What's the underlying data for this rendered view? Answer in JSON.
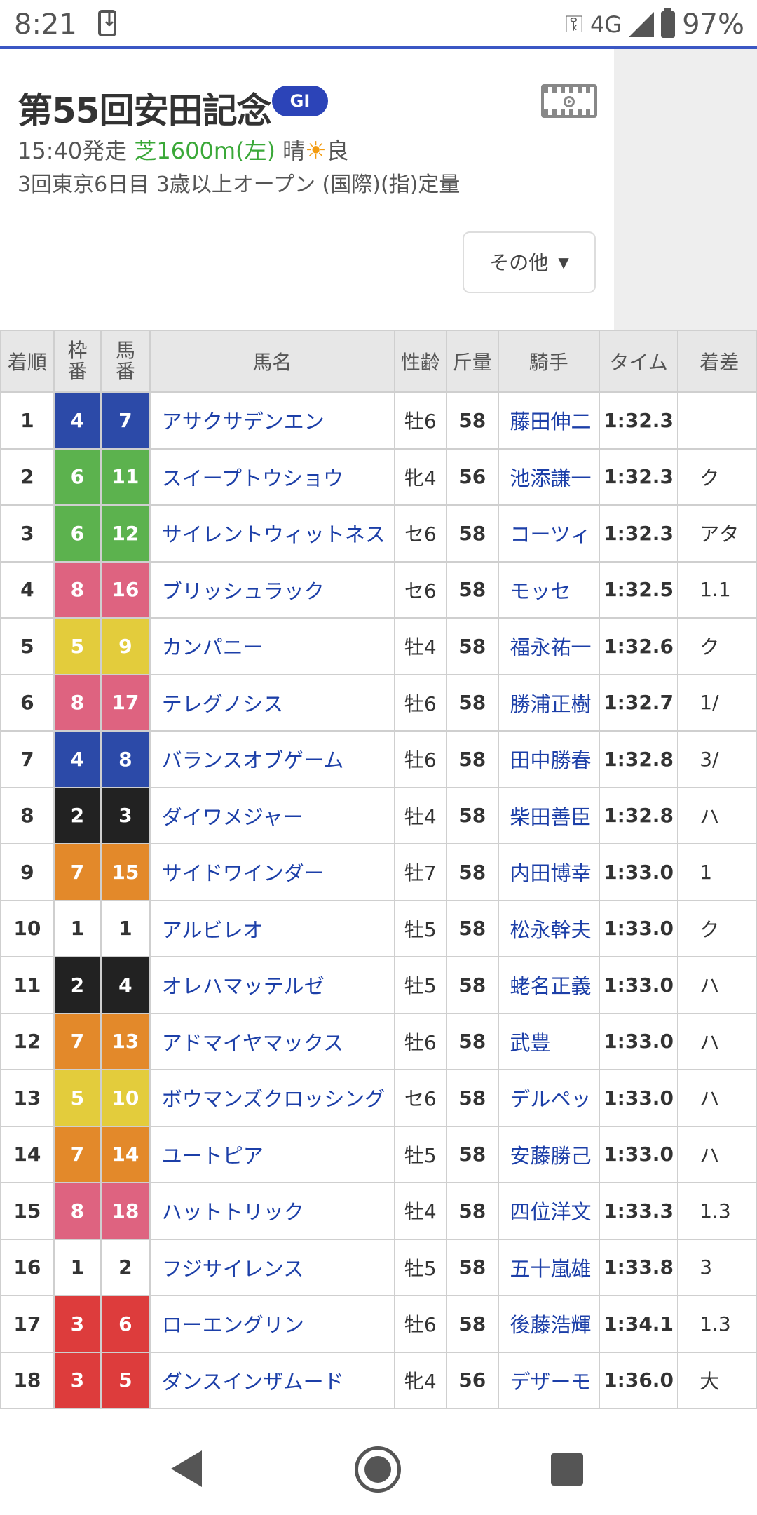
{
  "status": {
    "time": "8:21",
    "network": "4G",
    "battery": "97%"
  },
  "race": {
    "title": "第55回安田記念",
    "grade": "GI",
    "post_time": "15:40発走",
    "course": "芝1600m(左)",
    "weather": "晴",
    "going": "良",
    "conditions": "3回東京6日目 3歳以上オープン (国際)(指)定量",
    "other_button": "その他"
  },
  "table": {
    "headers": {
      "rank": "着順",
      "waku": "枠番",
      "umaban": "馬番",
      "name": "馬名",
      "sexage": "性齢",
      "weight": "斤量",
      "jockey": "騎手",
      "time": "タイム",
      "margin": "着差"
    },
    "rows": [
      {
        "rank": "1",
        "waku": "4",
        "umaban": "7",
        "name": "アサクサデンエン",
        "sexage": "牡6",
        "weight": "58",
        "jockey": "藤田伸二",
        "time": "1:32.3",
        "margin": ""
      },
      {
        "rank": "2",
        "waku": "6",
        "umaban": "11",
        "name": "スイープトウショウ",
        "sexage": "牝4",
        "weight": "56",
        "jockey": "池添謙一",
        "time": "1:32.3",
        "margin": "ク"
      },
      {
        "rank": "3",
        "waku": "6",
        "umaban": "12",
        "name": "サイレントウィットネス",
        "sexage": "セ6",
        "weight": "58",
        "jockey": "コーツィ",
        "time": "1:32.3",
        "margin": "アタ"
      },
      {
        "rank": "4",
        "waku": "8",
        "umaban": "16",
        "name": "ブリッシュラック",
        "sexage": "セ6",
        "weight": "58",
        "jockey": "モッセ",
        "time": "1:32.5",
        "margin": "1.1"
      },
      {
        "rank": "5",
        "waku": "5",
        "umaban": "9",
        "name": "カンパニー",
        "sexage": "牡4",
        "weight": "58",
        "jockey": "福永祐一",
        "time": "1:32.6",
        "margin": "ク"
      },
      {
        "rank": "6",
        "waku": "8",
        "umaban": "17",
        "name": "テレグノシス",
        "sexage": "牡6",
        "weight": "58",
        "jockey": "勝浦正樹",
        "time": "1:32.7",
        "margin": "1/"
      },
      {
        "rank": "7",
        "waku": "4",
        "umaban": "8",
        "name": "バランスオブゲーム",
        "sexage": "牡6",
        "weight": "58",
        "jockey": "田中勝春",
        "time": "1:32.8",
        "margin": "3/"
      },
      {
        "rank": "8",
        "waku": "2",
        "umaban": "3",
        "name": "ダイワメジャー",
        "sexage": "牡4",
        "weight": "58",
        "jockey": "柴田善臣",
        "time": "1:32.8",
        "margin": "ハ"
      },
      {
        "rank": "9",
        "waku": "7",
        "umaban": "15",
        "name": "サイドワインダー",
        "sexage": "牡7",
        "weight": "58",
        "jockey": "内田博幸",
        "time": "1:33.0",
        "margin": "1"
      },
      {
        "rank": "10",
        "waku": "1",
        "umaban": "1",
        "name": "アルビレオ",
        "sexage": "牡5",
        "weight": "58",
        "jockey": "松永幹夫",
        "time": "1:33.0",
        "margin": "ク"
      },
      {
        "rank": "11",
        "waku": "2",
        "umaban": "4",
        "name": "オレハマッテルゼ",
        "sexage": "牡5",
        "weight": "58",
        "jockey": "蛯名正義",
        "time": "1:33.0",
        "margin": "ハ"
      },
      {
        "rank": "12",
        "waku": "7",
        "umaban": "13",
        "name": "アドマイヤマックス",
        "sexage": "牡6",
        "weight": "58",
        "jockey": "武豊",
        "time": "1:33.0",
        "margin": "ハ"
      },
      {
        "rank": "13",
        "waku": "5",
        "umaban": "10",
        "name": "ボウマンズクロッシング",
        "sexage": "セ6",
        "weight": "58",
        "jockey": "デルペッ",
        "time": "1:33.0",
        "margin": "ハ"
      },
      {
        "rank": "14",
        "waku": "7",
        "umaban": "14",
        "name": "ユートピア",
        "sexage": "牡5",
        "weight": "58",
        "jockey": "安藤勝己",
        "time": "1:33.0",
        "margin": "ハ"
      },
      {
        "rank": "15",
        "waku": "8",
        "umaban": "18",
        "name": "ハットトリック",
        "sexage": "牡4",
        "weight": "58",
        "jockey": "四位洋文",
        "time": "1:33.3",
        "margin": "1.3"
      },
      {
        "rank": "16",
        "waku": "1",
        "umaban": "2",
        "name": "フジサイレンス",
        "sexage": "牡5",
        "weight": "58",
        "jockey": "五十嵐雄",
        "time": "1:33.8",
        "margin": "3"
      },
      {
        "rank": "17",
        "waku": "3",
        "umaban": "6",
        "name": "ローエングリン",
        "sexage": "牡6",
        "weight": "58",
        "jockey": "後藤浩輝",
        "time": "1:34.1",
        "margin": "1.3"
      },
      {
        "rank": "18",
        "waku": "3",
        "umaban": "5",
        "name": "ダンスインザムード",
        "sexage": "牝4",
        "weight": "56",
        "jockey": "デザーモ",
        "time": "1:36.0",
        "margin": "大"
      }
    ]
  },
  "waku_colors": {
    "1": {
      "bg": "#ffffff",
      "fg": "#333333"
    },
    "2": {
      "bg": "#222222",
      "fg": "#ffffff"
    },
    "3": {
      "bg": "#dd3c3c",
      "fg": "#ffffff"
    },
    "4": {
      "bg": "#2c4aa8",
      "fg": "#ffffff"
    },
    "5": {
      "bg": "#e3cc3c",
      "fg": "#ffffff"
    },
    "6": {
      "bg": "#5cb24e",
      "fg": "#ffffff"
    },
    "7": {
      "bg": "#e3892a",
      "fg": "#ffffff"
    },
    "8": {
      "bg": "#de6380",
      "fg": "#ffffff"
    }
  }
}
